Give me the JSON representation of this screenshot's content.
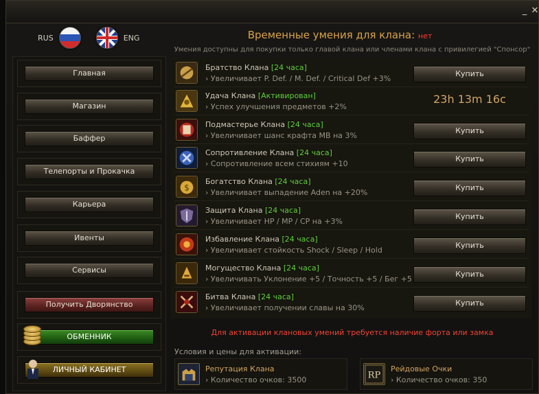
{
  "lang": {
    "ru": "RUS",
    "en": "ENG"
  },
  "sidebar": {
    "items": [
      {
        "label": "Главная"
      },
      {
        "label": "Магазин"
      },
      {
        "label": "Баффер"
      },
      {
        "label": "Телепорты и Прокачка"
      },
      {
        "label": "Карьера"
      },
      {
        "label": "Ивенты"
      },
      {
        "label": "Сервисы"
      },
      {
        "label": "Получить Дворянство"
      },
      {
        "label": "ОБМЕННИК"
      },
      {
        "label": "ЛИЧНЫЙ КАБИНЕТ"
      }
    ]
  },
  "main": {
    "title": "Временные умения для клана:",
    "status": "нет",
    "subtitle": "Умения доступны для покупки только главой клана или членами клана с привилегией \"Спонсор\"",
    "buy_label": "Купить",
    "skills": [
      {
        "name": "Братство Клана",
        "duration": "[24 часа]",
        "desc": "› Увеличивает P. Def. / M. Def. / Critical Def +3%"
      },
      {
        "name": "Удача Клана",
        "duration": "[Активирован]",
        "desc": "› Успех улучшения предметов +2%",
        "timer": "23h 13m 16c"
      },
      {
        "name": "Подмастерье Клана",
        "duration": "[24 часа]",
        "desc": "› Увеличивает шанс крафта MB на 3%"
      },
      {
        "name": "Сопротивление Клана",
        "duration": "[24 часа]",
        "desc": "› Сопротивление всем стихиям +10"
      },
      {
        "name": "Богатство Клана",
        "duration": "[24 часа]",
        "desc": "› Увеличивает выпадение Aden на +20%"
      },
      {
        "name": "Защита Клана",
        "duration": "[24 часа]",
        "desc": "› Увеличивает HP / MP / CP на +3%"
      },
      {
        "name": "Избавление Клана",
        "duration": "[24 часа]",
        "desc": "› Увеличивает стойкость Shock / Sleep / Hold"
      },
      {
        "name": "Могущество Клана",
        "duration": "[24 часа]",
        "desc": "› Увеличивать Уклонение +5 / Точность +5 / Бег +5"
      },
      {
        "name": "Битва Клана",
        "duration": "[24 часа]",
        "desc": "› Увеличивает получении славы на 30%"
      }
    ],
    "requirement": "Для активации клановых умений требуется наличие форта или замка",
    "conditions_title": "Условия и цены для активации:",
    "conditions": [
      {
        "name": "Репутация Клана",
        "value": "› Количество очков: 3500"
      },
      {
        "name": "Рейдовые Очки",
        "value": "› Количество очков: 350",
        "icon_text": "RP"
      }
    ]
  },
  "titlebar": {
    "minimize": "_",
    "close": "✕"
  }
}
